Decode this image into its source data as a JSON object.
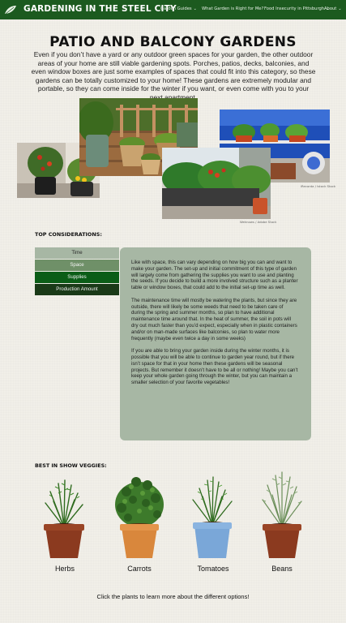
{
  "nav": {
    "brand": "GARDENING IN THE STEEL CITY",
    "menu": [
      "Garden Guides",
      "What Garden is Right for Me?",
      "Food Insecurity in Pittsburgh",
      "About"
    ],
    "bg_color": "#1c5a1f"
  },
  "page": {
    "title": "PATIO AND BALCONY GARDENS",
    "intro": "Even if you don’t have a yard or any outdoor green spaces for your garden, the other outdoor areas of your home are still viable gardening spots. Porches, patios, decks, balconies, and even window boxes are just some examples of spaces that could fit into this category, so these gardens can be totally customized to your home! These gardens are extremely modular and portable, so they can come inside for the winter if you want, or even come with you to your next apartment."
  },
  "photos": {
    "caption_right": "iRecorda / Istock Stock",
    "caption_center": "Weknows / Adobe Stock"
  },
  "considerations": {
    "heading": "TOP CONSIDERATIONS:",
    "tabs": [
      "Time",
      "Space",
      "Supplies",
      "Production Amount"
    ],
    "active_tab": "Time",
    "paragraphs": [
      "Like with space, this can vary depending on how big you can and want to make your garden. The set-up and initial commitment of this type of garden will largely come from gathering the supplies you want to use and planting the seeds. If you decide to build a more involved structure such as a planter table or window boxes, that could add to the initial set-up time as well.",
      "The maintenance time will mostly be watering the plants, but since they are outside, there will likely be some weeds that need to be taken care of during the spring and summer months, so plan to have additional maintenance time around that. In the heat of summer, the soil in pots will dry out much faster than you’d expect, especially when in plastic containers and/or on man-made surfaces like balconies, so plan to water more frequently (maybe even twice a day in some weeks)",
      "If you are able to bring your garden inside during the winter months, it is possible that you will be able to continue to garden year round, but if there isn’t space for that in your home then these gardens will be seasonal projects. But remember it doesn’t have to be all or nothing! Maybe you can’t keep your whole garden going through the winter, but you can maintain a smaller selection of your favorite vegetables!"
    ]
  },
  "veggies": {
    "heading": "BEST IN SHOW VEGGIES:",
    "items": [
      {
        "label": "Herbs",
        "pot_color": "#8b3a1f"
      },
      {
        "label": "Carrots",
        "pot_color": "#d9873c"
      },
      {
        "label": "Tomatoes",
        "pot_color": "#7aa7d8"
      },
      {
        "label": "Beans",
        "pot_color": "#8b3a1f"
      }
    ],
    "footer": "Click the plants to learn more about the different options!"
  }
}
